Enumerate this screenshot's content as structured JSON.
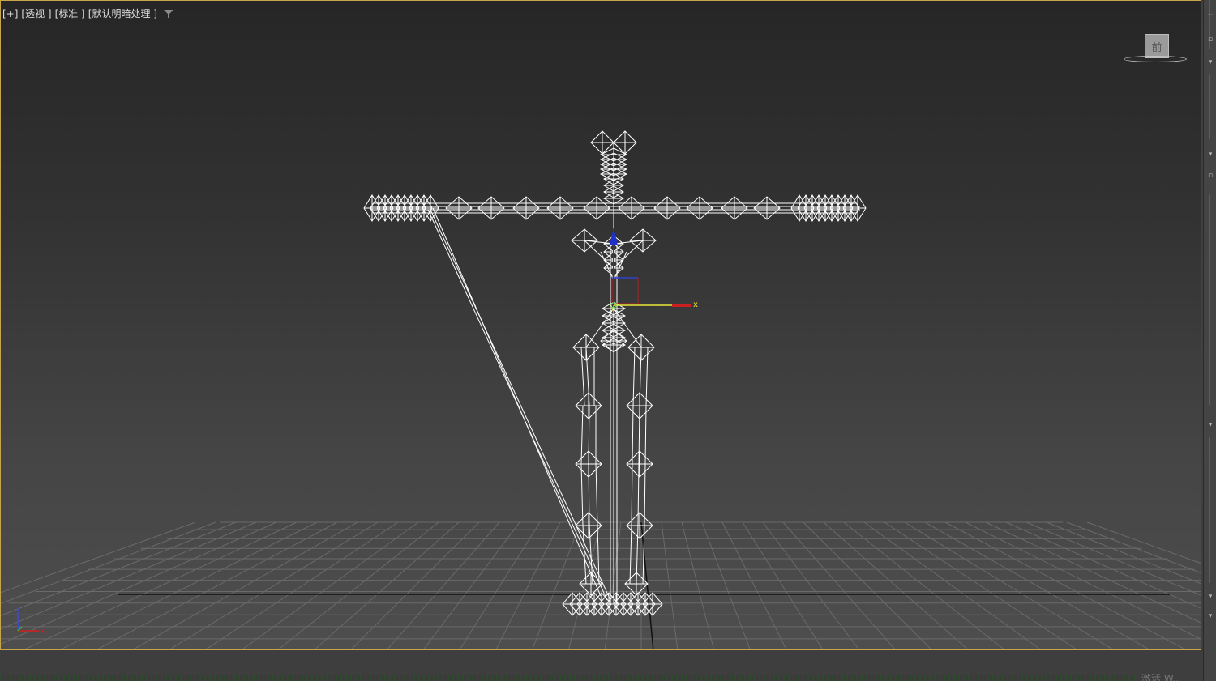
{
  "viewport": {
    "labels": [
      "[+]",
      "[透视 ]",
      "[标准 ]",
      "[默认明暗处理 ]"
    ]
  },
  "viewcube": {
    "face_label": "前"
  },
  "gizmo": {
    "x_label": "x",
    "y_label": "y"
  },
  "axis_tripod": {
    "z_label": "z",
    "x_label": "x"
  },
  "icons": {
    "filter": "filter-icon"
  },
  "colors": {
    "viewport_border": "#c8a44a",
    "axis_x": "#cc1f1f",
    "axis_y": "#e8e83a",
    "axis_z": "#2030d0"
  },
  "watermark": {
    "text": "激活 W..."
  }
}
